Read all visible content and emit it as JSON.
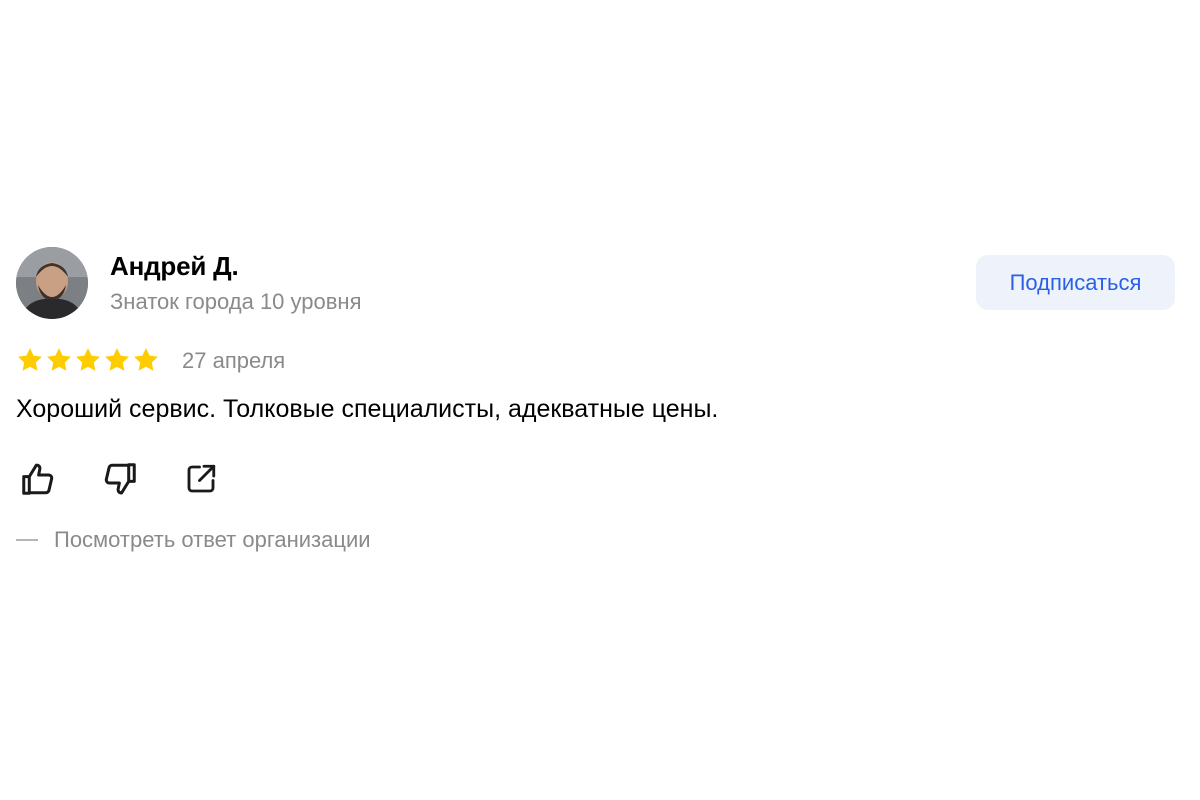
{
  "review": {
    "author": {
      "name": "Андрей Д.",
      "level": "Знаток города 10 уровня"
    },
    "subscribe_label": "Подписаться",
    "rating": {
      "value": 5,
      "max": 5,
      "star_color": "#ffcc00"
    },
    "date": "27 апреля",
    "text": "Хороший сервис. Толковые специалисты, адекватные цены.",
    "actions": {
      "like_icon": "thumbs-up-icon",
      "dislike_icon": "thumbs-down-icon",
      "share_icon": "share-icon"
    },
    "org_response_label": "Посмотреть ответ организации"
  },
  "colors": {
    "accent_blue": "#2c5fe8",
    "button_bg": "#eef3fb",
    "muted_text": "#8a8a8a"
  }
}
